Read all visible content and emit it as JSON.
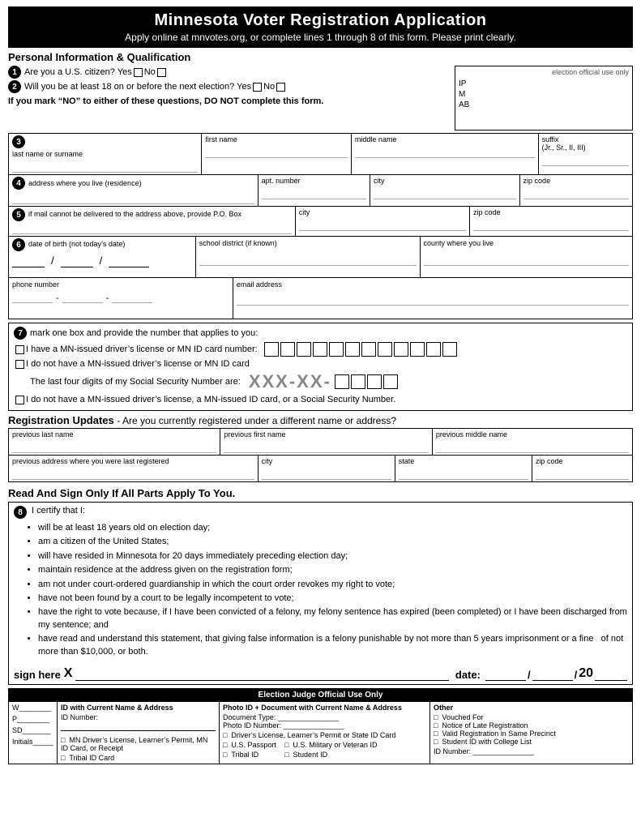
{
  "header": {
    "title": "Minnesota Voter Registration Application",
    "subtitle": "Apply online at mnvotes.org, or complete lines 1 through 8 of this form. Please print clearly."
  },
  "sections": {
    "personal_info_title": "Personal Information & Qualification",
    "q1": {
      "num": "1",
      "text": "Are you a U.S. citizen?  Yes",
      "text2": "No"
    },
    "q2": {
      "num": "2",
      "text": "Will you be at least 18 on or before the next election?  Yes",
      "text2": "No"
    },
    "warning": "If you mark “NO” to either of these questions, DO NOT complete this form.",
    "election_official_label": "election official   use only",
    "election_official_items": [
      "IP",
      "M",
      "AB"
    ],
    "num3": "3",
    "fields_name": [
      {
        "label": "last name or surname",
        "width": "31%"
      },
      {
        "label": "first  name",
        "width": "24%"
      },
      {
        "label": "middle name",
        "width": "30%"
      },
      {
        "label": "suffix\n(Jr., Sr., II, III)",
        "width": "15%"
      }
    ],
    "num4": "4",
    "fields_address": [
      {
        "label": "address where you live (residence)",
        "width": "40%"
      },
      {
        "label": "apt. number",
        "width": "18%"
      },
      {
        "label": "city",
        "width": "24%"
      },
      {
        "label": "zip code",
        "width": "18%"
      }
    ],
    "num5": "5",
    "fields_mail": [
      {
        "label": "if mail cannot be delivered to the address above, provide P.O. Box",
        "width": "46%"
      },
      {
        "label": "city",
        "width": "28%"
      },
      {
        "label": "zip code",
        "width": "26%"
      }
    ],
    "num6": "6",
    "dob_label": "date of birth (not today’s date)",
    "school_label": "school district (if known)",
    "county_label": "county where you live",
    "phone_label": "phone number",
    "email_label": "email address",
    "dob_slashes": "/         /",
    "phone_dashes": "-           -",
    "num7": "7",
    "s7_intro": "mark one box and provide the number that applies to you:",
    "s7_opt1": "I have a MN-issued driver’s license or MN ID card number:",
    "s7_opt2": "I do not have a MN-issued driver’s license or MN ID card",
    "s7_opt2b": "The last four digits of my Social Security Number are:",
    "s7_opt3": "I do not have a MN-issued driver’s license, a MN-issued ID card, or a Social Security Number.",
    "ssn_placeholder": "XXX-XX-",
    "reg_updates_title": "Registration Updates",
    "reg_updates_subtitle": "- Are you currently registered under a different name or address?",
    "prev_fields_top": [
      {
        "label": "previous last name",
        "width": "34%"
      },
      {
        "label": "previous first  name",
        "width": "34%"
      },
      {
        "label": "previous middle name",
        "width": "32%"
      }
    ],
    "prev_fields_bottom": [
      {
        "label": "previous address where you were last registered",
        "width": "40%"
      },
      {
        "label": "city",
        "width": "22%"
      },
      {
        "label": "state",
        "width": "22%"
      },
      {
        "label": "zip code",
        "width": "16%"
      }
    ],
    "sign_title": "Read And Sign Only If All Parts Apply To You.",
    "num8": "8",
    "certify_intro": "I certify that I:",
    "certify_bullets": [
      "will be at least 18 years old on election day;",
      "am a citizen of the United States;",
      "will have resided in Minnesota for 20 days immediately preceding election day;",
      "maintain residence at the address given on the registration form;",
      "am not under court-ordered guardianship in which the court order revokes my right to vote;",
      "have not been found by a court to be legally incompetent to vote;",
      "have the right to vote because, if I have been convicted of a felony, my felony sentence has expired (been completed) or I have been discharged from my sentence; and",
      "have read and understand this statement, that giving false information is a felony punishable by not more than 5 years imprisonment or a fine   of not more than $10,000, or both."
    ],
    "sign_label": "sign here",
    "sign_x": "X",
    "date_label": "date:",
    "date_year": "20",
    "bottom_header": "Election Judge Official Use Only",
    "bottom_cols": {
      "left_rows": [
        "W",
        "P",
        "SD",
        "Initials"
      ],
      "col1_title": "ID with Current Name & Address",
      "col1_items": [
        "ID Number:",
        "",
        "□  MN Driver’s License, Learner’s Permit, MN ID Card, or Receipt",
        "□  Tribal ID Card"
      ],
      "col2_title": "Photo ID + Document with Current Name & Address",
      "col2_items": [
        "Document Type: _______________",
        "Photo ID Number: _______________",
        "□  Driver’s License, Learner’s Permit or State ID Card",
        "□  U.S. Passport       □  U.S. Military or Veteran ID",
        "□  Tribal ID                 □  Student ID"
      ],
      "col3_title": "Other",
      "col3_items": [
        "□  Vouched For",
        "□  Notice of Late Registration",
        "□  Valid Registration in Same Precinct",
        "□  Student ID with College List",
        "ID Number: _______________"
      ]
    }
  }
}
